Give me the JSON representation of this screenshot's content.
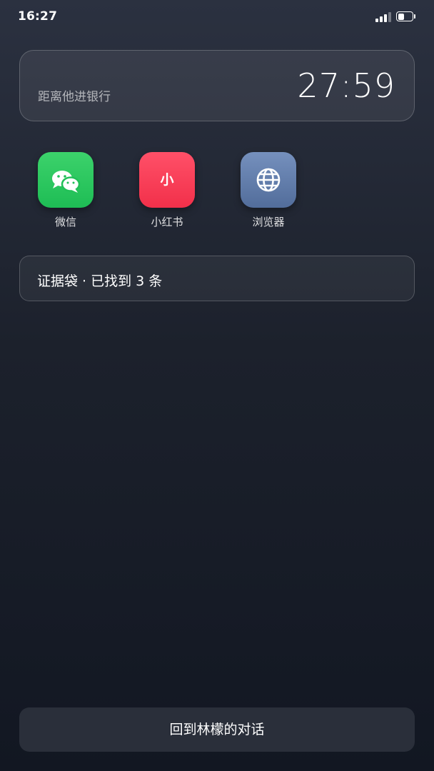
{
  "status_bar": {
    "time": "16:27",
    "icons": [
      "signal-icon",
      "battery-icon"
    ],
    "battery_level": 0.45
  },
  "countdown": {
    "label": "距离他进银行",
    "time": "27:59"
  },
  "apps": [
    {
      "name": "微信",
      "icon": "wechat-icon",
      "color": "#27c25c"
    },
    {
      "name": "小红书",
      "icon": "xiaohongshu-icon",
      "glyph": "小",
      "color": "#f83d56"
    },
    {
      "name": "浏览器",
      "icon": "globe-icon",
      "color": "#6680ad"
    }
  ],
  "evidence": {
    "text": "证据袋 · 已找到 3 条"
  },
  "bottom_button": {
    "label": "回到林檬的对话"
  }
}
